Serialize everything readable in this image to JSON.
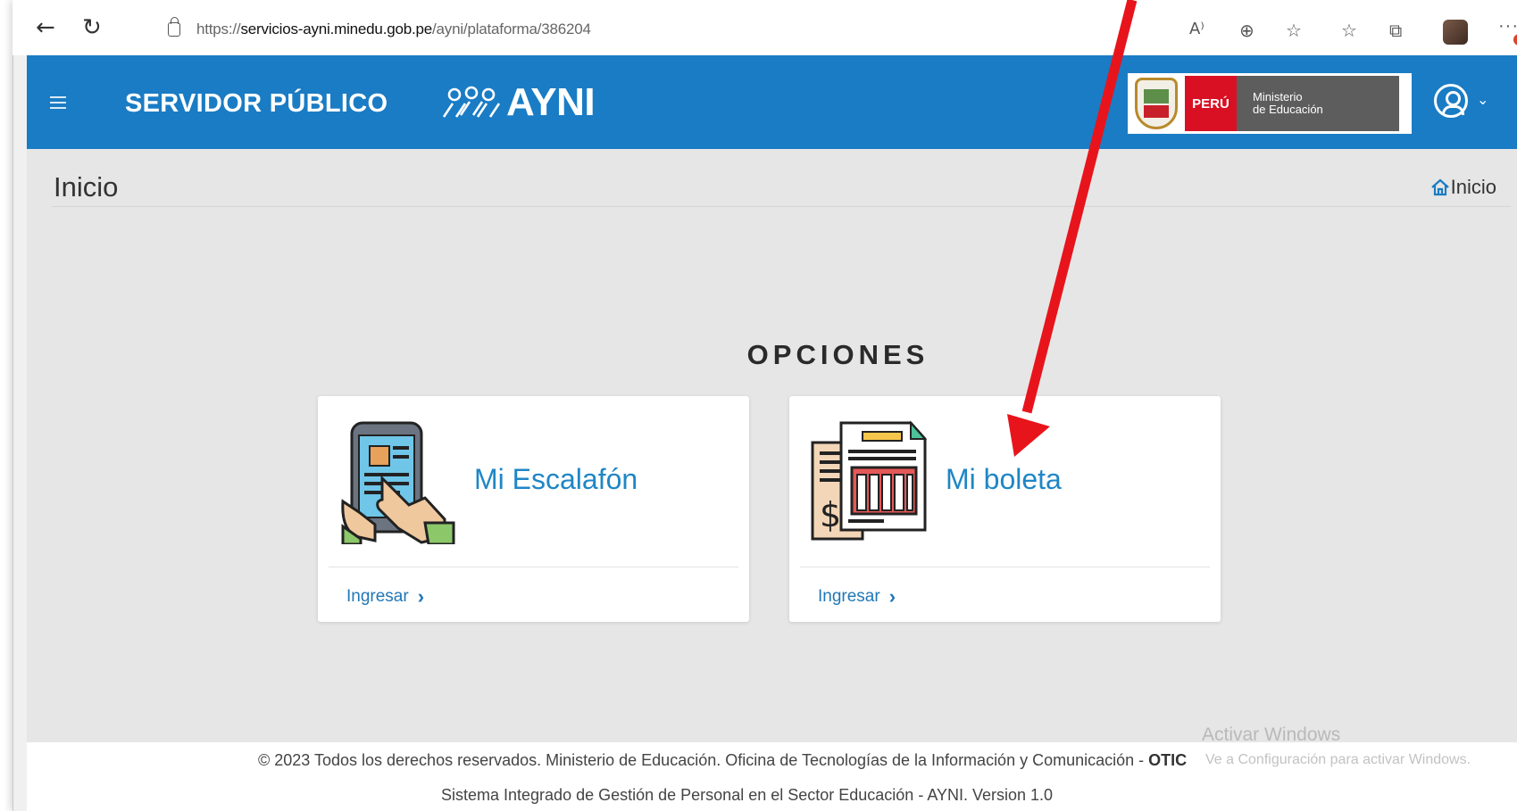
{
  "browser": {
    "back_icon": "←",
    "reload_icon": "↻",
    "url_prefix": "https://",
    "url_host": "servicios-ayni.minedu.gob.pe",
    "url_path": "/ayni/plataforma/386204",
    "read_aloud_icon": "A⁾",
    "zoom_icon": "⊕",
    "favorites_add_icon": "☆",
    "favorites_icon": "☆",
    "collections_icon": "⧉",
    "more_icon": "···"
  },
  "header": {
    "title": "SERVIDOR PÚBLICO",
    "logo_text": "AYNI",
    "peru_label": "PERÚ",
    "ministerio_line1": "Ministerio",
    "ministerio_line2": "de Educación",
    "user_caret": "⌄",
    "accent_color": "#1a7cc4"
  },
  "breadcrumb": {
    "page_title": "Inicio",
    "home_label": "Inicio"
  },
  "main": {
    "section_title": "OPCIONES",
    "cards": [
      {
        "title": "Mi Escalafón",
        "link_label": "Ingresar",
        "icon": "tablet-touch-icon"
      },
      {
        "title": "Mi boleta",
        "link_label": "Ingresar",
        "icon": "invoice-document-icon"
      }
    ]
  },
  "footer": {
    "line1_text": "© 2023 Todos los derechos reservados. Ministerio de Educación. Oficina de Tecnologías de la Información y Comunicación - ",
    "line1_bold": "OTIC",
    "line2": "Sistema Integrado de Gestión de Personal en el Sector Educación - AYNI. Version 1.0"
  },
  "watermark": {
    "line1": "Activar Windows",
    "line2": "Ve a Configuración para activar Windows."
  },
  "annotation": {
    "arrow_color": "#e8141c"
  }
}
